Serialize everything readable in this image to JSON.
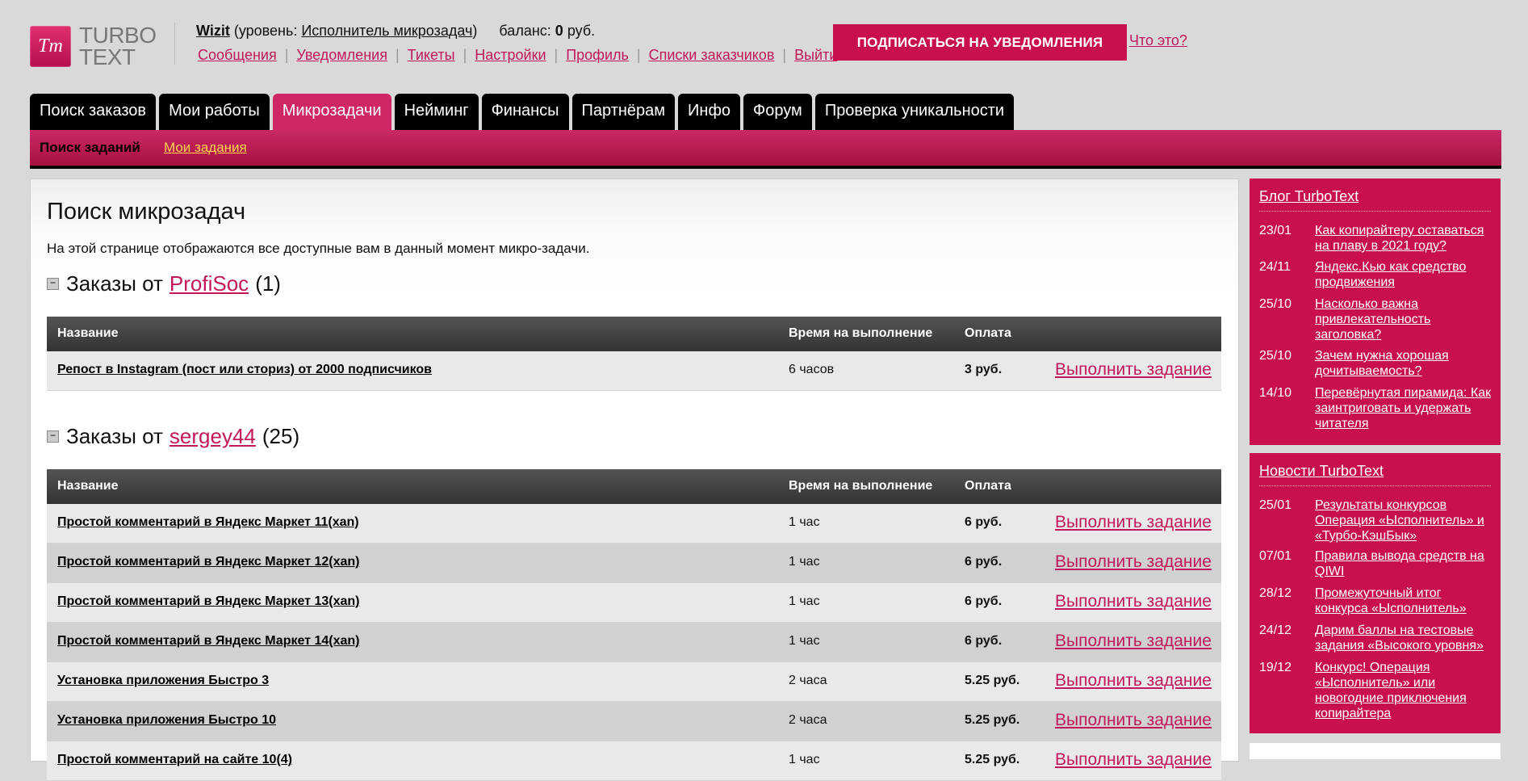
{
  "logo": {
    "mark": "Tт",
    "line1": "TURBO",
    "line2": "TEXT"
  },
  "user": {
    "name": "Wizit",
    "level_prefix": "(уровень: ",
    "level": "Исполнитель микрозадач",
    "level_suffix": ")",
    "balance_label": "баланс:",
    "balance_value": "0",
    "balance_unit": "руб."
  },
  "user_links": [
    "Сообщения",
    "Уведомления",
    "Тикеты",
    "Настройки",
    "Профиль",
    "Списки заказчиков",
    "Выйти"
  ],
  "subscribe_button": "ПОДПИСАТЬСЯ НА УВЕДОМЛЕНИЯ",
  "what_is_it": "Что это?",
  "tabs": [
    "Поиск заказов",
    "Мои работы",
    "Микрозадачи",
    "Нейминг",
    "Финансы",
    "Партнёрам",
    "Инфо",
    "Форум",
    "Проверка уникальности"
  ],
  "active_tab": "Микрозадачи",
  "subnav": {
    "current": "Поиск заданий",
    "link": "Мои задания"
  },
  "page": {
    "title": "Поиск микрозадач",
    "intro": "На этой странице отображаются все доступные вам в данный момент микро-задачи."
  },
  "table_headers": {
    "name": "Название",
    "time": "Время на выполнение",
    "pay": "Оплата"
  },
  "sections": [
    {
      "prefix": "Заказы от",
      "customer": "ProfiSoc",
      "count": "(1)",
      "rows": [
        {
          "name": "Репост в Instagram (пост или сториз) от 2000 подписчиков",
          "time": "6 часов",
          "pay": "3 руб.",
          "action": "Выполнить задание"
        }
      ]
    },
    {
      "prefix": "Заказы от",
      "customer": "sergey44",
      "count": "(25)",
      "rows": [
        {
          "name": "Простой комментарий в Яндекс Маркет 11(xan)",
          "time": "1 час",
          "pay": "6 руб.",
          "action": "Выполнить задание"
        },
        {
          "name": "Простой комментарий в Яндекс Маркет 12(xan)",
          "time": "1 час",
          "pay": "6 руб.",
          "action": "Выполнить задание"
        },
        {
          "name": "Простой комментарий в Яндекс Маркет 13(xan)",
          "time": "1 час",
          "pay": "6 руб.",
          "action": "Выполнить задание"
        },
        {
          "name": "Простой комментарий в Яндекс Маркет 14(xan)",
          "time": "1 час",
          "pay": "6 руб.",
          "action": "Выполнить задание"
        },
        {
          "name": "Установка приложения Быстро 3",
          "time": "2 часа",
          "pay": "5.25 руб.",
          "action": "Выполнить задание"
        },
        {
          "name": "Установка приложения Быстро 10",
          "time": "2 часа",
          "pay": "5.25 руб.",
          "action": "Выполнить задание"
        },
        {
          "name": "Простой комментарий на сайте 10(4)",
          "time": "1 час",
          "pay": "5.25 руб.",
          "action": "Выполнить задание"
        }
      ]
    }
  ],
  "sidebar": {
    "blog": {
      "title": "Блог TurboText",
      "items": [
        {
          "date": "23/01",
          "text": "Как копирайтеру оставаться на плаву в 2021 году?"
        },
        {
          "date": "24/11",
          "text": "Яндекс.Кью как средство продвижения"
        },
        {
          "date": "25/10",
          "text": "Насколько важна привлекательность заголовка?"
        },
        {
          "date": "25/10",
          "text": "Зачем нужна хорошая дочитываемость?"
        },
        {
          "date": "14/10",
          "text": "Перевёрнутая пирамида: Как заинтриговать и удержать читателя"
        }
      ]
    },
    "news": {
      "title": "Новости TurboText",
      "items": [
        {
          "date": "25/01",
          "text": "Результаты конкурсов Операция «Ысполнитель» и «Турбо-КэшБык»"
        },
        {
          "date": "07/01",
          "text": "Правила вывода средств на QIWI"
        },
        {
          "date": "28/12",
          "text": "Промежуточный итог конкурса «Ысполнитель»"
        },
        {
          "date": "24/12",
          "text": "Дарим баллы на тестовые задания «Высокого уровня»"
        },
        {
          "date": "19/12",
          "text": "Конкурс! Операция «Ысполнитель» или новогодние приключения копирайтера"
        }
      ]
    }
  },
  "colors": {
    "accent": "#c8104f",
    "active_tab": "#cf2764",
    "link": "#c2185b",
    "subnav_link": "#ffd54f"
  }
}
